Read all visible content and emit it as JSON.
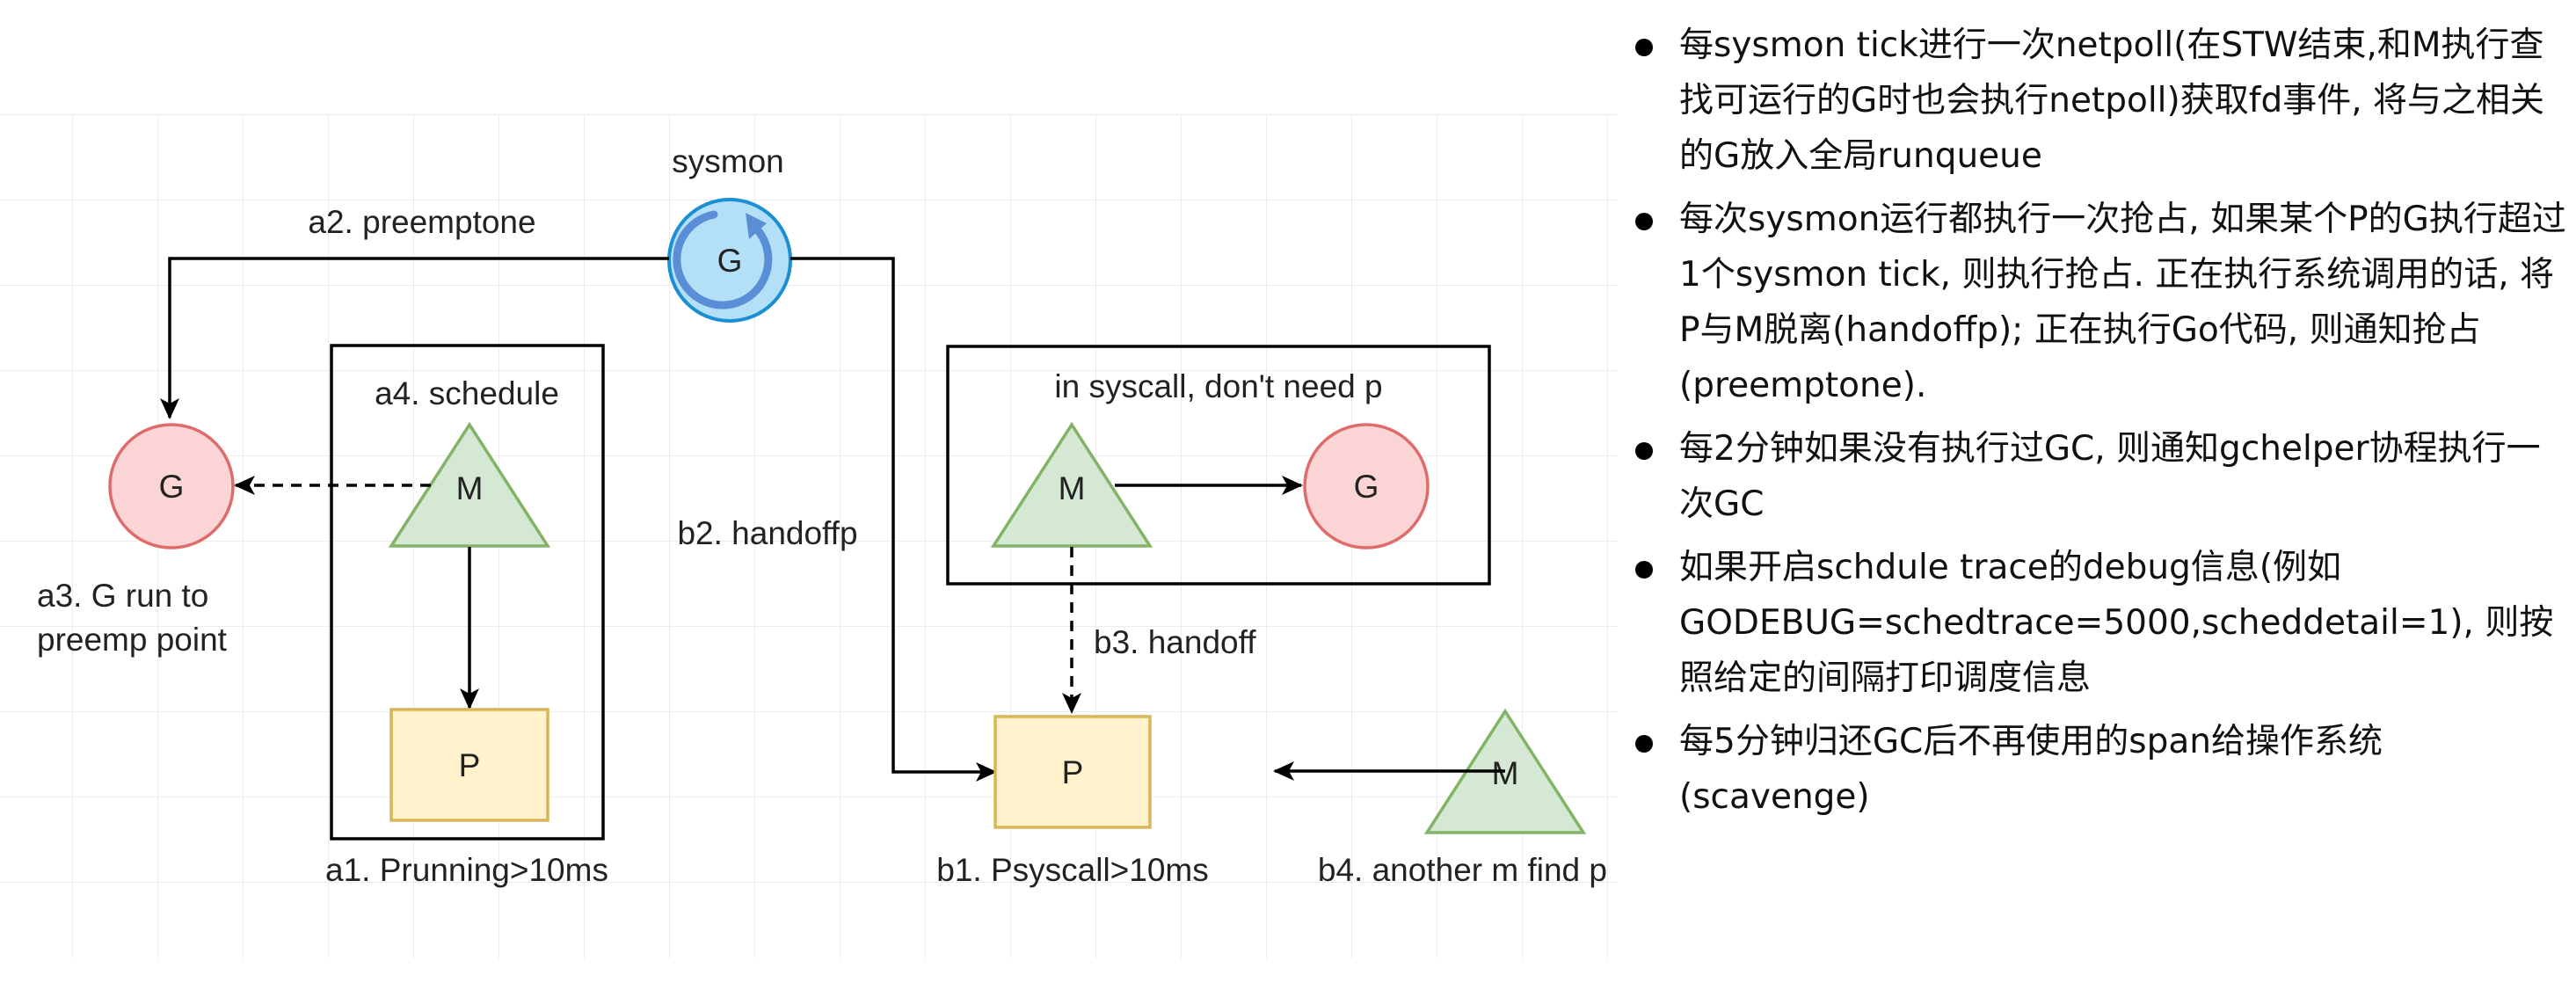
{
  "diagram": {
    "sysmon_label": "sysmon",
    "sysmon_node": "G",
    "a1": "a1. Prunning>10ms",
    "a2": "a2. preemptone",
    "a3_line1": "a3. G run to",
    "a3_line2": "preemp point",
    "a4": "a4. schedule",
    "b1": "b1. Psyscall>10ms",
    "b2": "b2. handoffp",
    "b3": "b3. handoff",
    "b4": "b4. another m find p",
    "syscall_box": "in syscall, don't need p",
    "g_left": "G",
    "m_a": "M",
    "p_a": "P",
    "m_b": "M",
    "g_b": "G",
    "p_b": "P",
    "m_b4": "M"
  },
  "colors": {
    "sysmon_fill": "#b3e0f7",
    "sysmon_stroke": "#1b8fd1",
    "sysmon_icon": "#5a8fd8",
    "g_fill": "#fbd5d5",
    "g_stroke": "#e06b6b",
    "m_fill": "#d5e8d4",
    "m_stroke": "#82b366",
    "p_fill": "#fff2cc",
    "p_stroke": "#d6b656",
    "grid": "#ececec"
  },
  "bullets": [
    "每sysmon tick进行一次netpoll(在STW结束,和M执行查找可运行的G时也会执行netpoll)获取fd事件, 将与之相关的G放入全局runqueue",
    "每次sysmon运行都执行一次抢占, 如果某个P的G执行超过1个sysmon tick, 则执行抢占. 正在执行系统调用的话, 将P与M脱离(handoffp); 正在执行Go代码, 则通知抢占(preemptone).",
    "每2分钟如果没有执行过GC, 则通知gchelper协程执行一次GC",
    "如果开启schdule trace的debug信息(例如GODEBUG=schedtrace=5000,scheddetail=1), 则按照给定的间隔打印调度信息",
    "每5分钟归还GC后不再使用的span给操作系统(scavenge)"
  ]
}
